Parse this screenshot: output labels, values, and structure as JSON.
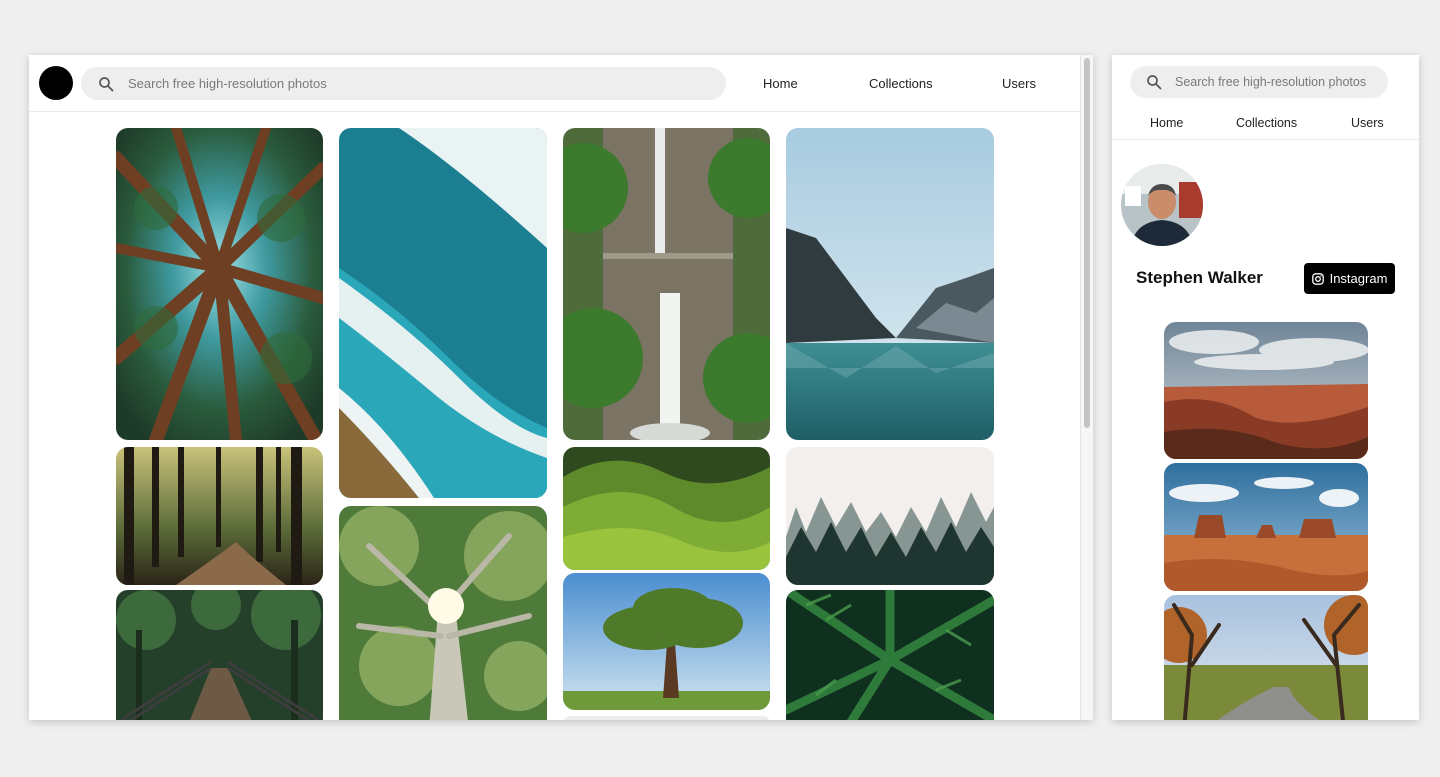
{
  "main": {
    "search": {
      "placeholder": "Search free high-resolution photos",
      "value": ""
    },
    "nav": [
      {
        "label": "Home"
      },
      {
        "label": "Collections"
      },
      {
        "label": "Users"
      }
    ],
    "photos": [
      {
        "subject": "redwood-canopy"
      },
      {
        "subject": "forest-path"
      },
      {
        "subject": "forest-bridge"
      },
      {
        "subject": "ocean-waves-aerial"
      },
      {
        "subject": "tree-sunburst"
      },
      {
        "subject": "waterfall"
      },
      {
        "subject": "green-hills"
      },
      {
        "subject": "lone-tree"
      },
      {
        "subject": "mountain-lake"
      },
      {
        "subject": "misty-forest"
      },
      {
        "subject": "fern-leaves"
      }
    ]
  },
  "side": {
    "search": {
      "placeholder": "Search free high-resolution photos",
      "value": ""
    },
    "nav": [
      {
        "label": "Home"
      },
      {
        "label": "Collections"
      },
      {
        "label": "Users"
      }
    ],
    "profile": {
      "name": "Stephen Walker",
      "instagram_label": "Instagram"
    },
    "photos": [
      {
        "subject": "grand-canyon"
      },
      {
        "subject": "monument-valley"
      },
      {
        "subject": "autumn-road"
      }
    ]
  },
  "icons": {
    "search": "search-icon",
    "instagram": "instagram-icon",
    "logo": "logo-circle"
  },
  "colors": {
    "background": "#efefef",
    "search_bg": "#eeeeee",
    "button": "#000000"
  }
}
